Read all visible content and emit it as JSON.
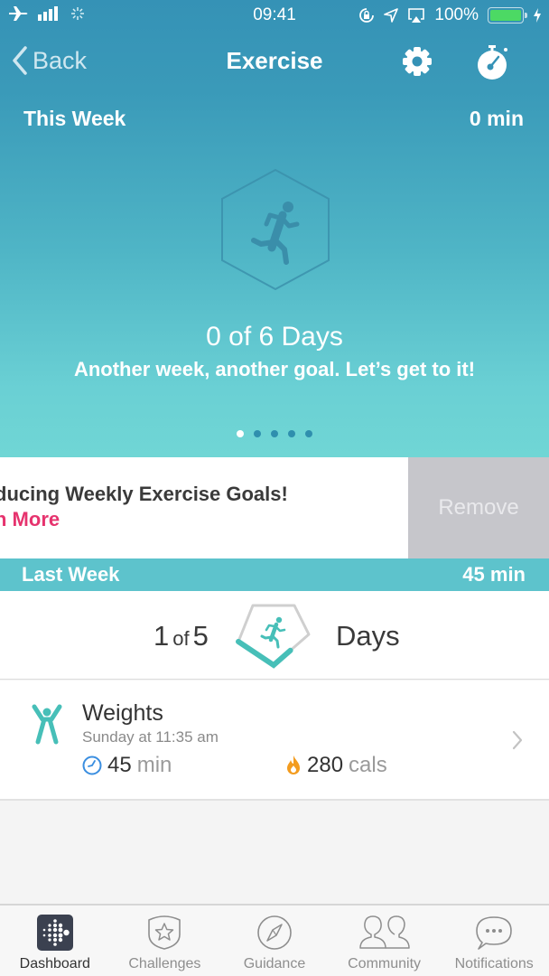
{
  "status_bar": {
    "time": "09:41",
    "battery": "100%",
    "icons": [
      "airplane-icon",
      "signal-icon",
      "activity-spinner-icon",
      "rotation-lock-icon",
      "location-icon",
      "airplay-icon",
      "battery-icon",
      "charging-icon"
    ]
  },
  "nav": {
    "back_label": "Back",
    "title": "Exercise",
    "settings_icon": "gear-icon",
    "timer_icon": "stopwatch-icon"
  },
  "this_week": {
    "label": "This Week",
    "total": "0 min",
    "days_text": "0 of 6 Days",
    "days_done": 0,
    "days_goal": 6,
    "motto": "Another week, another goal. Let’s get to it!",
    "page_count": 5,
    "page_active": 1
  },
  "promo": {
    "title": "ducing Weekly Exercise Goals!",
    "link": "n More",
    "remove_label": "Remove",
    "link_color": "#e6336e"
  },
  "last_week": {
    "label": "Last Week",
    "total": "45 min",
    "count": "1",
    "of_label": "of",
    "goal": "5",
    "days_label": "Days",
    "progress_fraction": 0.2
  },
  "activities": [
    {
      "name": "Weights",
      "when": "Sunday at 11:35 am",
      "duration_value": "45",
      "duration_unit": "min",
      "calories_value": "280",
      "calories_unit": "cals"
    }
  ],
  "tabbar": {
    "items": [
      {
        "label": "Dashboard",
        "icon": "dashboard-icon",
        "active": true
      },
      {
        "label": "Challenges",
        "icon": "challenges-icon",
        "active": false
      },
      {
        "label": "Guidance",
        "icon": "compass-icon",
        "active": false
      },
      {
        "label": "Community",
        "icon": "community-icon",
        "active": false
      },
      {
        "label": "Notifications",
        "icon": "chat-bubble-icon",
        "active": false
      }
    ]
  },
  "colors": {
    "accent_teal": "#47bfb8",
    "header_blue": "#3592b6",
    "bar_teal": "#5dc3cc"
  }
}
